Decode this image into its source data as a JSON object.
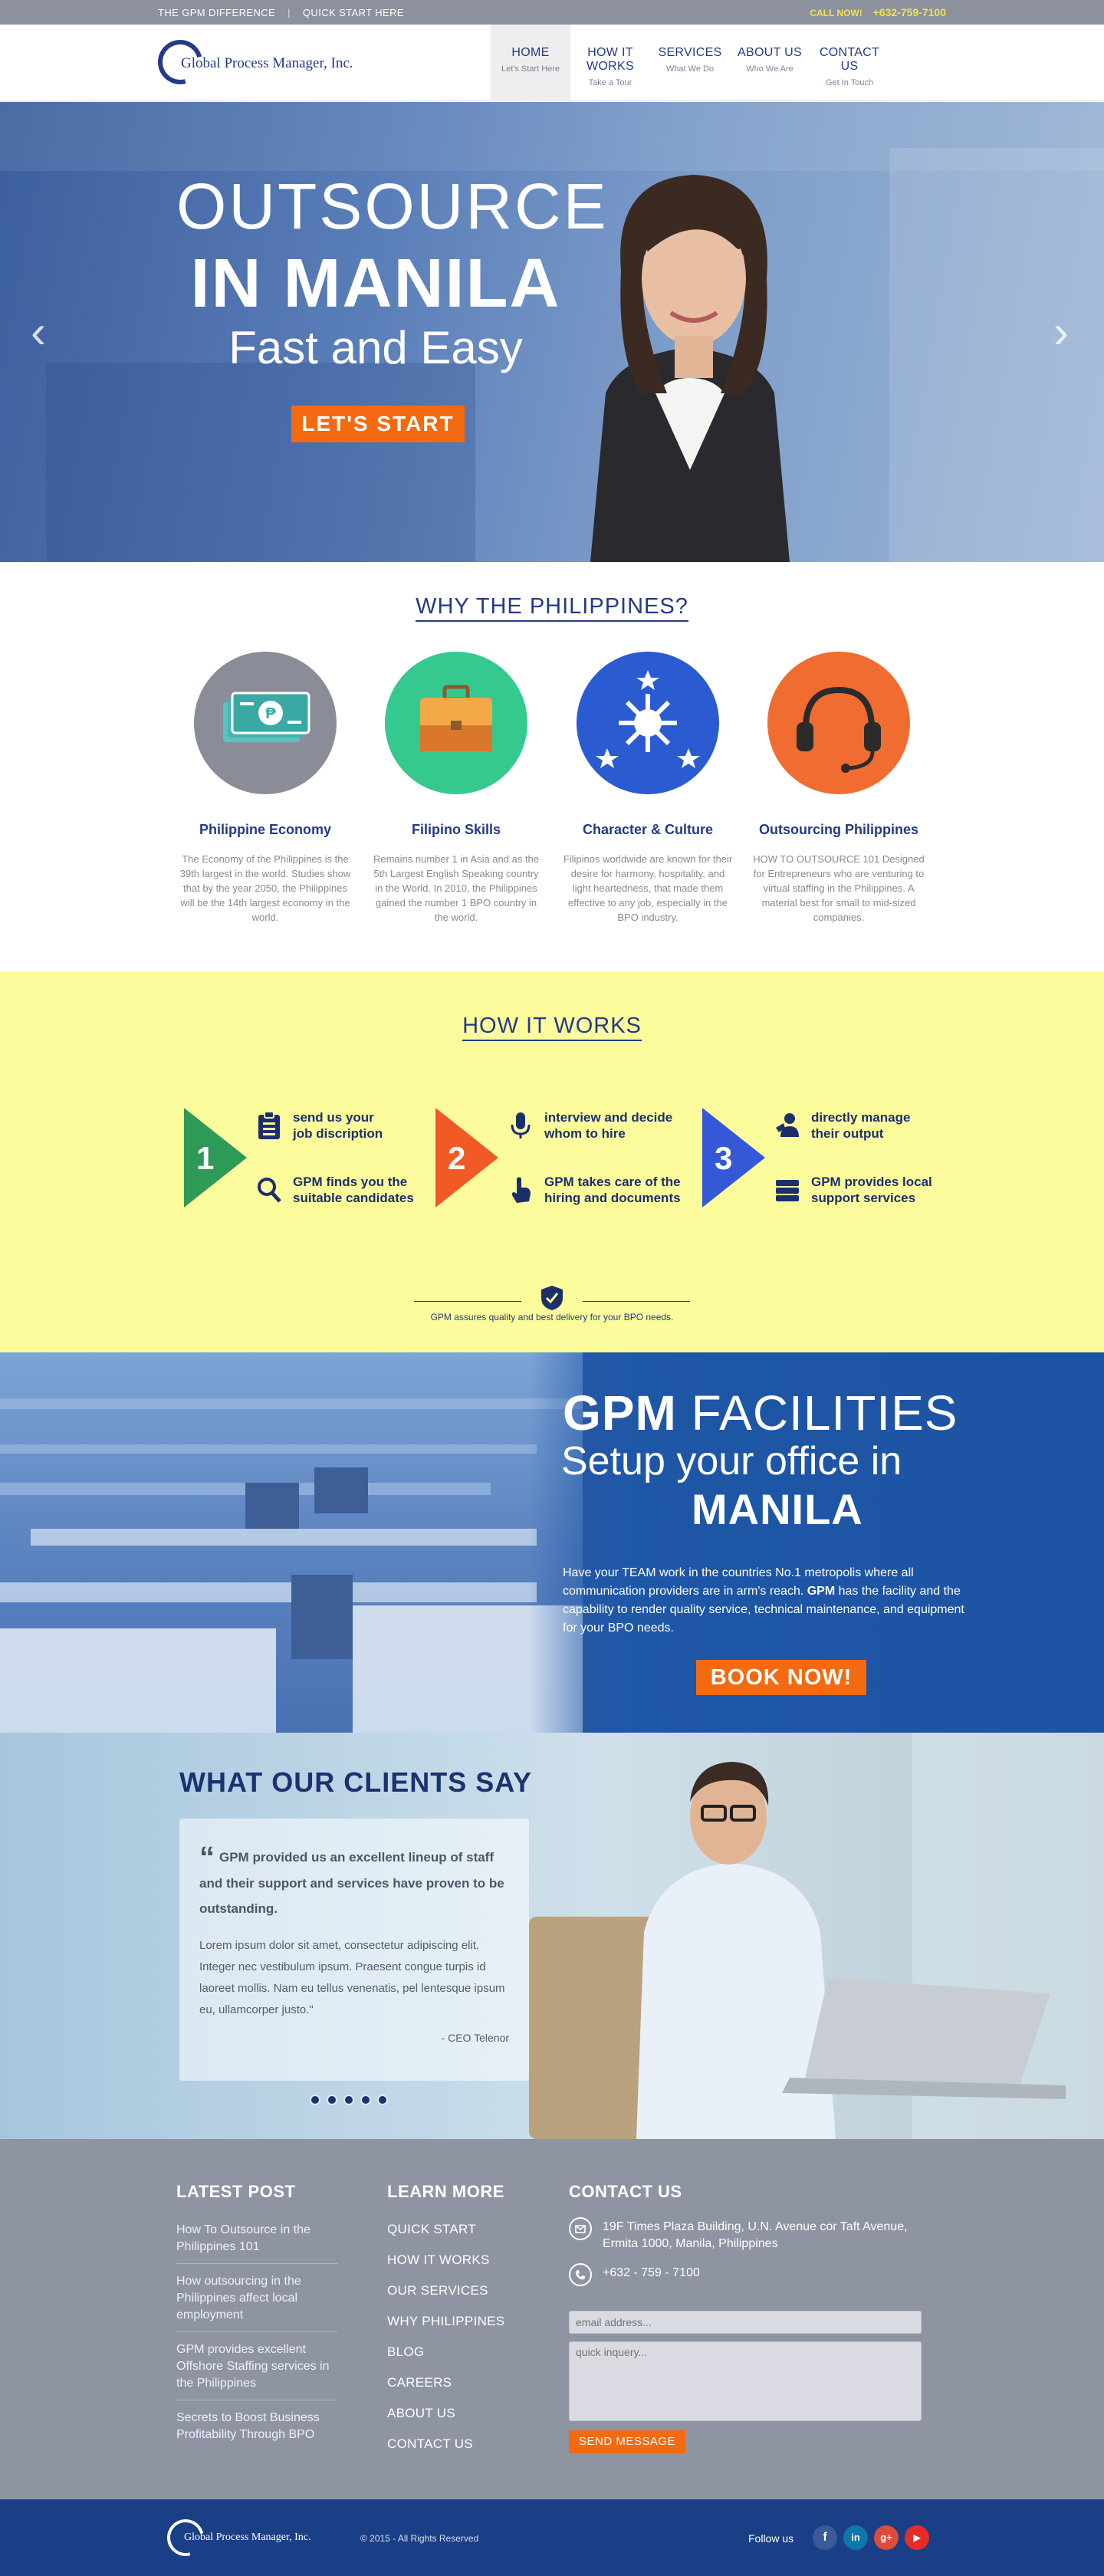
{
  "topbar": {
    "link1": "THE GPM DIFFERENCE",
    "sep": "|",
    "link2": "QUICK START HERE",
    "call_label": "CALL NOW!",
    "phone": "+632-759-7100"
  },
  "logo": {
    "text": "Global Process Manager, Inc."
  },
  "nav": [
    {
      "title": "HOME",
      "sub": "Let's Start Here",
      "active": true
    },
    {
      "title": "HOW IT WORKS",
      "sub": "Take a Tour"
    },
    {
      "title": "SERVICES",
      "sub": "What We Do"
    },
    {
      "title": "ABOUT US",
      "sub": "Who We Are"
    },
    {
      "title": "CONTACT US",
      "sub": "Get In Touch"
    }
  ],
  "hero": {
    "line1": "OUTSOURCE",
    "line2": "IN MANILA",
    "line3": "Fast and Easy",
    "button": "LET'S  START",
    "prev_icon": "‹",
    "next_icon": "›"
  },
  "why": {
    "title": "WHY THE PHILIPPINES?",
    "features": [
      {
        "title": "Philippine Economy",
        "icon": "money-icon",
        "text": "The Economy of the Philippines is the 39th largest in the world. Studies show that by the year 2050, the Philippines will be the 14th largest economy in the world."
      },
      {
        "title": "Filipino Skills",
        "icon": "briefcase-icon",
        "text": "Remains number 1 in Asia and as the 5th Largest English Speaking country in the World. In 2010, the Philippines gained the number 1 BPO country in the world."
      },
      {
        "title": "Character & Culture",
        "icon": "sun-stars-icon",
        "text": "Filipinos worldwide are known for their desire for harmony, hospitality, and light heartedness, that made them effective to any job, especially in the BPO industry."
      },
      {
        "title": "Outsourcing Philippines",
        "icon": "headset-icon",
        "text": "HOW TO OUTSOURCE 101 Designed for Entrepreneurs who are venturing to virtual staffing in the Philippines. A material best for small to mid-sized companies."
      }
    ]
  },
  "how": {
    "title": "HOW IT WORKS",
    "steps": [
      {
        "num": "1",
        "items": [
          "send us your\njob discription",
          "GPM finds you the\nsuitable candidates"
        ]
      },
      {
        "num": "2",
        "items": [
          "interview and decide\nwhom to hire",
          "GPM takes care of the\nhiring and documents"
        ]
      },
      {
        "num": "3",
        "items": [
          "directly manage\ntheir output",
          "GPM provides local\nsupport services"
        ]
      }
    ],
    "quality": "GPM assures quality and best delivery for your  BPO needs."
  },
  "facilities": {
    "h1_bold": "GPM",
    "h1_rest": " FACILITIES",
    "h2": "Setup your office in",
    "h3": "MANILA",
    "p_a": "Have your TEAM work in the countries No.1 metropolis where all communication providers are in arm's reach. ",
    "p_b": "GPM",
    "p_c": " has the facility and the capability to render quality service, technical maintenance, and equipment for your BPO needs.",
    "button": "BOOK NOW!"
  },
  "clients": {
    "title": "WHAT OUR CLIENTS SAY",
    "quote_mark": "“",
    "quote": "GPM provided us an excellent lineup of staff and their support and services have proven to be outstanding.",
    "body": "Lorem ipsum dolor sit amet, consectetur adipiscing elit. Integer nec vestibulum ipsum. Praesent congue turpis id laoreet mollis. Nam eu tellus venenatis, pel lentesque ipsum eu, ullamcorper justo.\"",
    "author": "- CEO Telenor"
  },
  "footer": {
    "latest_title": "LATEST POST",
    "latest": [
      "How To Outsource in the Philippines 101",
      "How outsourcing in the Philippines affect local employment",
      "GPM provides excellent Offshore Staffing services in the Philippines",
      "Secrets to Boost Business Profitability Through BPO"
    ],
    "learn_title": "LEARN MORE",
    "learn": [
      "QUICK START",
      "HOW IT WORKS",
      "OUR SERVICES",
      "WHY PHILIPPINES",
      "BLOG",
      "CAREERS",
      "ABOUT US",
      "CONTACT US"
    ],
    "contact_title": "CONTACT US",
    "address": "19F Times Plaza Building, U.N. Avenue cor Taft Avenue, Ermita 1000, Manila, Philippines",
    "phone": "+632 - 759 - 7100",
    "email_placeholder": "email address...",
    "inquiry_placeholder": "quick inquery...",
    "send": "SEND MESSAGE"
  },
  "bottom": {
    "logo": "Global Process Manager, Inc.",
    "copyright": "© 2015 - All Rights Reserved",
    "follow": "Follow us",
    "social": [
      "f",
      "in",
      "g+",
      "▶"
    ]
  },
  "colors": {
    "navy": "#233a86",
    "orange": "#f36a10",
    "yellow": "#fdfc9d",
    "footer": "#8f94a3",
    "bottom": "#1b3f86"
  }
}
